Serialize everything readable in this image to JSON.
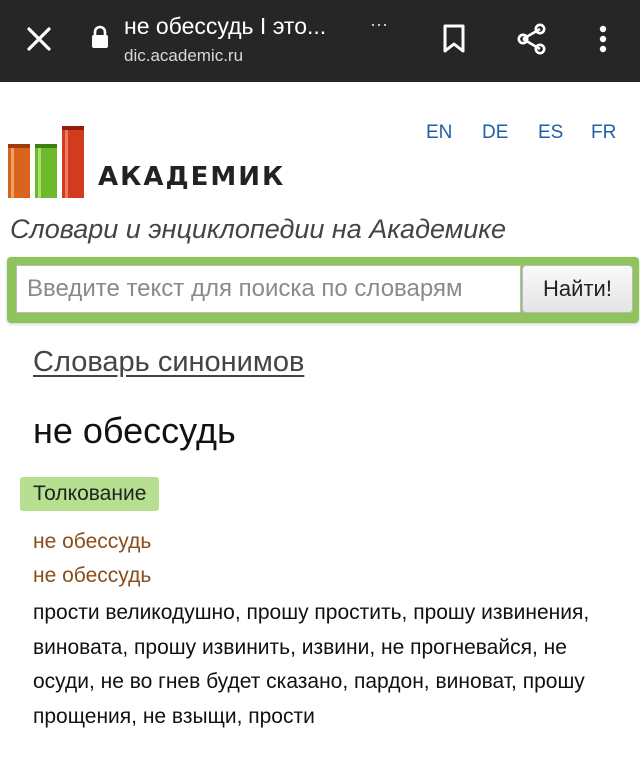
{
  "browser": {
    "page_title": "не обессудь I это...",
    "more": "···",
    "url": "dic.academic.ru",
    "icons": [
      "close-icon",
      "lock-icon",
      "bookmark-icon",
      "share-icon",
      "more-vert-icon"
    ]
  },
  "site": {
    "logo_text": "АКАДЕМИК",
    "tagline": "Словари и энциклопедии на Академике",
    "languages": [
      "EN",
      "DE",
      "ES",
      "FR"
    ],
    "accent_color": "#8fc45c"
  },
  "search": {
    "placeholder": "Введите текст для поиска по словарям",
    "button_label": "Найти!"
  },
  "content": {
    "dictionary_link": "Словарь синонимов",
    "headword": "не обессудь",
    "section_badge": "Толкование",
    "variants": [
      "не обессудь",
      "не обессудь"
    ],
    "definition": "прости великодушно, прошу простить, прошу извинения, виновата, прошу извинить, извини, не прогневайся, не осуди, не во гнев будет сказано, пардон, виноват, прошу прощения, не взыщи, прости"
  }
}
